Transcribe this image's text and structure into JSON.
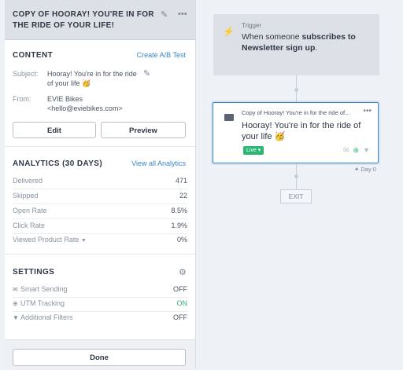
{
  "panel": {
    "title": "COPY OF HOORAY! YOU'RE IN FOR THE RIDE OF YOUR LIFE!",
    "content": {
      "heading": "CONTENT",
      "ab_link": "Create A/B Test",
      "subject_label": "Subject:",
      "subject_value": "Hooray! You're in for the ride of your life 🥳",
      "from_label": "From:",
      "from_name": "EVIE Bikes",
      "from_email": "<hello@eviebikes.com>",
      "edit_label": "Edit",
      "preview_label": "Preview"
    },
    "analytics": {
      "heading": "ANALYTICS (30 DAYS)",
      "view_all": "View all Analytics",
      "rows": [
        {
          "label": "Delivered",
          "value": "471"
        },
        {
          "label": "Skipped",
          "value": "22"
        },
        {
          "label": "Open Rate",
          "value": "8.5%"
        },
        {
          "label": "Click Rate",
          "value": "1.9%"
        },
        {
          "label": "Viewed Product Rate",
          "value": "0%"
        }
      ]
    },
    "settings": {
      "heading": "SETTINGS",
      "rows": [
        {
          "label": "Smart Sending",
          "value": "OFF"
        },
        {
          "label": "UTM Tracking",
          "value": "ON"
        },
        {
          "label": "Additional Filters",
          "value": "OFF"
        }
      ]
    },
    "done_label": "Done"
  },
  "flow": {
    "trigger": {
      "label": "Trigger",
      "text_prefix": "When someone ",
      "text_bold1": "subscribes to",
      "text_bold2": "Newsletter sign up",
      "text_suffix": "."
    },
    "email": {
      "small_title": "Copy of Hooray! You're in for the ride of...",
      "subject": "Hooray! You're in for the ride of your life 🥳",
      "status": "Live"
    },
    "delay": "Day 0",
    "exit": "EXIT"
  },
  "colors": {
    "accent": "#3a86c6",
    "live_green": "#2bb673"
  }
}
